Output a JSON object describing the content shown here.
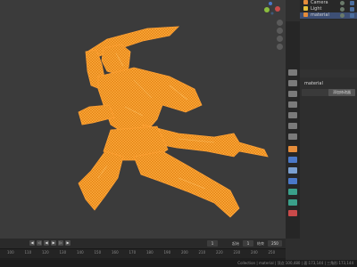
{
  "outliner": {
    "items": [
      {
        "label": "Camera",
        "icon": "camera-object-icon"
      },
      {
        "label": "Light",
        "icon": "light-object-icon"
      },
      {
        "label": "material",
        "icon": "mesh-object-icon",
        "selected": true
      }
    ]
  },
  "properties": {
    "object_name": "material",
    "button_label": "添加修改器"
  },
  "timeline": {
    "current_frame": "1",
    "start_label": "起始",
    "start_value": "1",
    "end_label": "结束",
    "end_value": "250",
    "ruler_ticks": [
      "100",
      "110",
      "120",
      "130",
      "140",
      "150",
      "160",
      "170",
      "180",
      "190",
      "200",
      "210",
      "220",
      "230",
      "240",
      "250"
    ]
  },
  "status": {
    "text": "Collection | material | 顶点:100,480 | 面:173,144 | 三角形:173,144"
  },
  "colors": {
    "wireframe": "#f0941f",
    "selection": "#3d4f75",
    "viewport_bg": "#3b3b3b"
  }
}
